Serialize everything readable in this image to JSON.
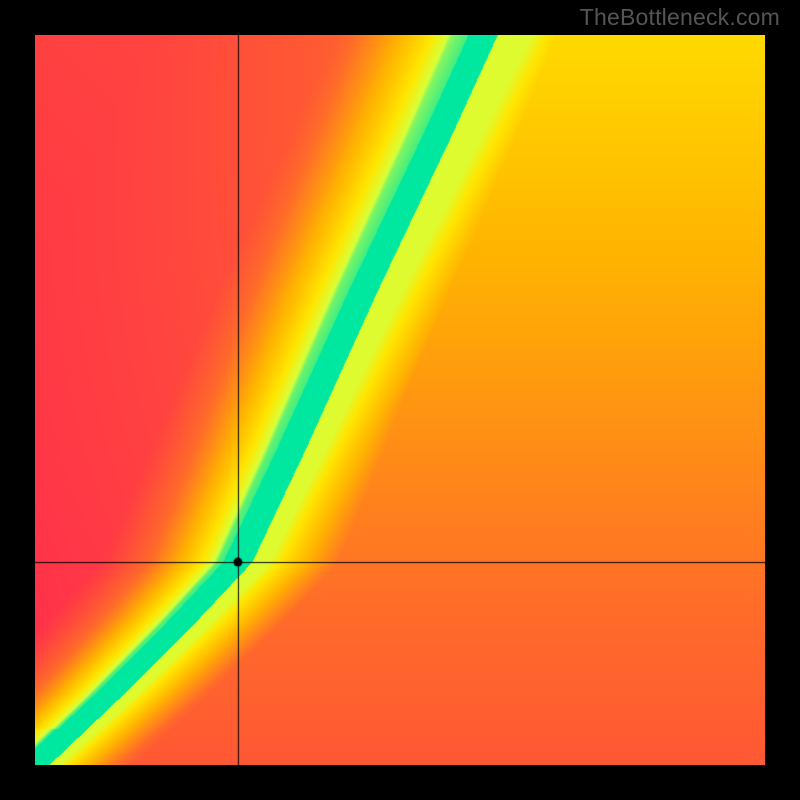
{
  "watermark": "TheBottleneck.com",
  "chart_data": {
    "type": "heatmap",
    "title": "",
    "xlabel": "",
    "ylabel": "",
    "xlim": [
      0,
      1
    ],
    "ylim": [
      0,
      1
    ],
    "marker": {
      "x": 0.278,
      "y": 0.278
    },
    "crosshair": {
      "x": 0.278,
      "y": 0.278
    },
    "ridge_description": "Green optimal band runs along a curve from origin to marker point (~linear y=x), then steepens to roughly y = 2.15*(x-0.278)+0.278 above it.",
    "ridge_samples": [
      {
        "x": 0.0,
        "y": 0.0
      },
      {
        "x": 0.1,
        "y": 0.095
      },
      {
        "x": 0.2,
        "y": 0.195
      },
      {
        "x": 0.278,
        "y": 0.278
      },
      {
        "x": 0.35,
        "y": 0.43
      },
      {
        "x": 0.45,
        "y": 0.65
      },
      {
        "x": 0.55,
        "y": 0.86
      },
      {
        "x": 0.614,
        "y": 1.0
      }
    ],
    "colorscale": [
      {
        "t": 0.0,
        "color": "#ff2b4d"
      },
      {
        "t": 0.35,
        "color": "#ff6a2a"
      },
      {
        "t": 0.6,
        "color": "#ffb400"
      },
      {
        "t": 0.8,
        "color": "#ffe600"
      },
      {
        "t": 0.92,
        "color": "#d8ff3a"
      },
      {
        "t": 1.0,
        "color": "#00e7a0"
      }
    ]
  }
}
